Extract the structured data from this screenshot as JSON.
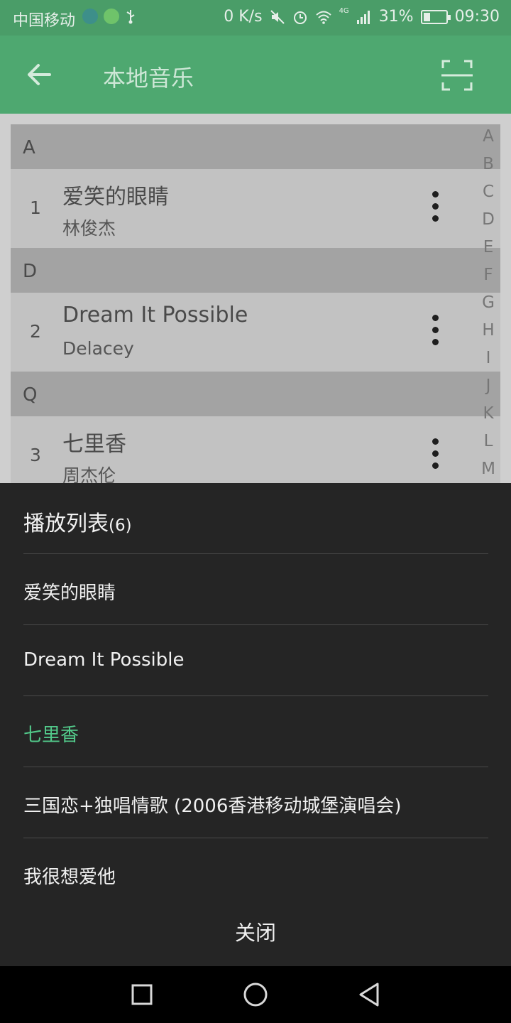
{
  "status_bar": {
    "carrier": "中国移动",
    "net_speed": "0 K/s",
    "network": "4G",
    "battery": "31%",
    "battery_level": 0.31,
    "time": "09:30",
    "icons": [
      "android-icon",
      "globe-icon",
      "usb-icon",
      "mute-icon",
      "alarm-icon",
      "wifi-icon",
      "signal-icon",
      "battery-icon"
    ]
  },
  "app_bar": {
    "title": "本地音乐",
    "icons": [
      "back-arrow-icon",
      "scan-icon"
    ]
  },
  "sections": [
    {
      "letter": "A",
      "song": {
        "index": "1",
        "title": "爱笑的眼睛",
        "artist": "林俊杰"
      }
    },
    {
      "letter": "D",
      "song": {
        "index": "2",
        "title": "Dream It Possible",
        "artist": "Delacey"
      }
    },
    {
      "letter": "Q",
      "song": {
        "index": "3",
        "title": "七里香",
        "artist": "周杰伦"
      }
    }
  ],
  "alphabet_index": [
    "A",
    "B",
    "C",
    "D",
    "E",
    "F",
    "G",
    "H",
    "I",
    "J",
    "K",
    "L",
    "M"
  ],
  "playlist": {
    "title": "播放列表",
    "count": "(6)",
    "items": [
      {
        "title": "爱笑的眼睛",
        "playing": false
      },
      {
        "title": "Dream It Possible",
        "playing": false
      },
      {
        "title": "七里香",
        "playing": true
      },
      {
        "title": "三国恋+独唱情歌 (2006香港移动城堡演唱会)",
        "playing": false
      },
      {
        "title": "我很想爱他",
        "playing": false
      }
    ],
    "close_label": "关闭"
  },
  "colors": {
    "app_bar": "#4ea870",
    "playing_accent": "#52c98a",
    "sheet_bg": "#252525"
  },
  "nav_bar": {
    "icons": [
      "recents-square-icon",
      "home-circle-icon",
      "back-triangle-icon"
    ]
  }
}
